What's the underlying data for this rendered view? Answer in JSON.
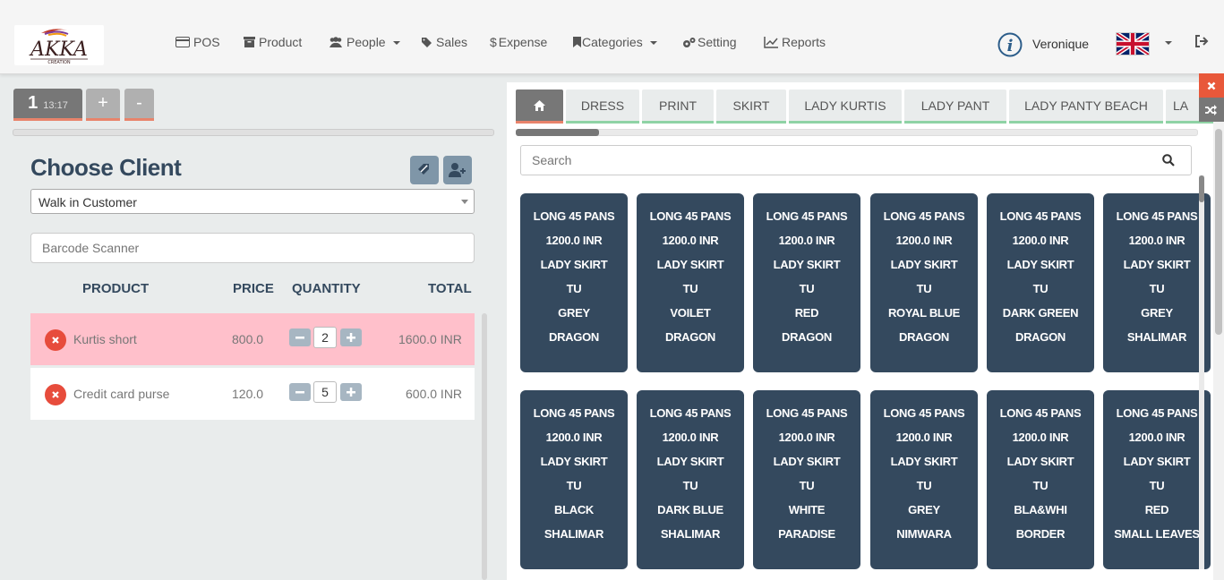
{
  "brand": {
    "logo_text": "AKKA",
    "logo_subtext": "CREATION"
  },
  "nav": [
    {
      "label": "POS",
      "icon": "credit-card-icon",
      "has_caret": false
    },
    {
      "label": "Product",
      "icon": "archive-icon",
      "has_caret": false
    },
    {
      "label": "People",
      "icon": "users-icon",
      "has_caret": true
    },
    {
      "label": "Sales",
      "icon": "tag-icon",
      "has_caret": false
    },
    {
      "label": "Expense",
      "icon": "dollar-icon",
      "has_caret": false
    },
    {
      "label": "Categories",
      "icon": "bookmark-icon",
      "has_caret": true
    },
    {
      "label": "Setting",
      "icon": "cogs-icon",
      "has_caret": false
    },
    {
      "label": "Reports",
      "icon": "line-chart-icon",
      "has_caret": false
    }
  ],
  "user": {
    "name": "Veronique",
    "language_flag": "uk-flag-icon"
  },
  "orders": {
    "active": {
      "number": "1",
      "time": "13:17"
    },
    "add_label": "+",
    "remove_label": "-"
  },
  "client": {
    "title": "Choose Client",
    "selected": "Walk in Customer",
    "barcode_placeholder": "Barcode Scanner"
  },
  "order_table": {
    "headers": {
      "product": "PRODUCT",
      "price": "PRICE",
      "quantity": "QUANTITY",
      "total": "TOTAL"
    },
    "rows": [
      {
        "product": "Kurtis short",
        "price": "800.0",
        "qty": "2",
        "total": "1600.0 INR"
      },
      {
        "product": "Credit card purse",
        "price": "120.0",
        "qty": "5",
        "total": "600.0 INR"
      }
    ]
  },
  "categories": [
    "DRESS",
    "PRINT",
    "SKIRT",
    "LADY KURTIS",
    "LADY PANT",
    "LADY PANTY BEACH",
    "LA"
  ],
  "search": {
    "placeholder": "Search"
  },
  "products": [
    [
      "LONG 45 PANS",
      "1200.0 INR",
      "LADY SKIRT",
      "TU",
      "GREY",
      "DRAGON"
    ],
    [
      "LONG 45 PANS",
      "1200.0 INR",
      "LADY SKIRT",
      "TU",
      "VOILET",
      "DRAGON"
    ],
    [
      "LONG 45 PANS",
      "1200.0 INR",
      "LADY SKIRT",
      "TU",
      "RED",
      "DRAGON"
    ],
    [
      "LONG 45 PANS",
      "1200.0 INR",
      "LADY SKIRT",
      "TU",
      "ROYAL BLUE",
      "DRAGON"
    ],
    [
      "LONG 45 PANS",
      "1200.0 INR",
      "LADY SKIRT",
      "TU",
      "DARK GREEN",
      "DRAGON"
    ],
    [
      "LONG 45 PANS",
      "1200.0 INR",
      "LADY SKIRT",
      "TU",
      "GREY",
      "SHALIMAR"
    ],
    [
      "LONG 45 PANS",
      "1200.0 INR",
      "LADY SKIRT",
      "TU",
      "BLACK",
      "SHALIMAR"
    ],
    [
      "LONG 45 PANS",
      "1200.0 INR",
      "LADY SKIRT",
      "TU",
      "DARK BLUE",
      "SHALIMAR"
    ],
    [
      "LONG 45 PANS",
      "1200.0 INR",
      "LADY SKIRT",
      "TU",
      "WHITE",
      "PARADISE"
    ],
    [
      "LONG 45 PANS",
      "1200.0 INR",
      "LADY SKIRT",
      "TU",
      "GREY",
      "NIMWARA"
    ],
    [
      "LONG 45 PANS",
      "1200.0 INR",
      "LADY SKIRT",
      "TU",
      "BLA&WHI",
      "BORDER"
    ],
    [
      "LONG 45 PANS",
      "1200.0 INR",
      "LADY SKIRT",
      "TU",
      "RED",
      "SMALL LEAVES"
    ]
  ],
  "colors": {
    "card_bg": "#34495e",
    "accent_orange": "#e8836b",
    "category_underline": "#8fd3a5",
    "highlight_row": "#ffc0cb",
    "remove_red": "#e74c3c"
  }
}
